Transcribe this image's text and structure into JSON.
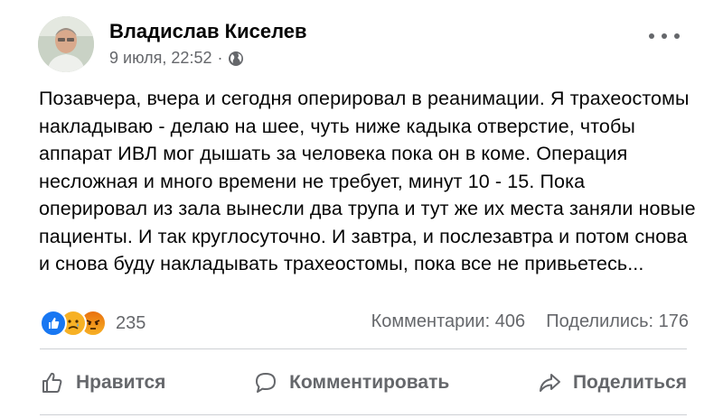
{
  "post": {
    "author": "Владислав Киселев",
    "date": "9 июля, 22:52",
    "separator": "·",
    "privacy_icon": "globe-icon",
    "more_icon": "ellipsis-icon",
    "text": "Позавчера, вчера и сегодня оперировал в реанимации. Я трахеостомы накладываю - делаю на шее, чуть ниже кадыка отверстие, чтобы аппарат ИВЛ мог дышать за человека пока он в коме. Операция несложная и много времени не требует, минут 10 - 15. Пока оперировал из зала вынесли два трупа и тут же их места заняли новые пациенты. И так круглосуточно. И завтра, и послезавтра и потом снова и снова буду накладывать трахеостомы, пока все не привьетесь..."
  },
  "reactions": {
    "icons": [
      "like-icon",
      "sad-icon",
      "angry-icon"
    ],
    "count": "235",
    "comments": "Комментарии: 406",
    "shares": "Поделились: 176"
  },
  "actions": {
    "like": "Нравится",
    "comment": "Комментировать",
    "share": "Поделиться"
  },
  "colors": {
    "text": "#050505",
    "secondary": "#65676b",
    "like_blue": "#1877f2",
    "divider": "#ced0d4"
  }
}
